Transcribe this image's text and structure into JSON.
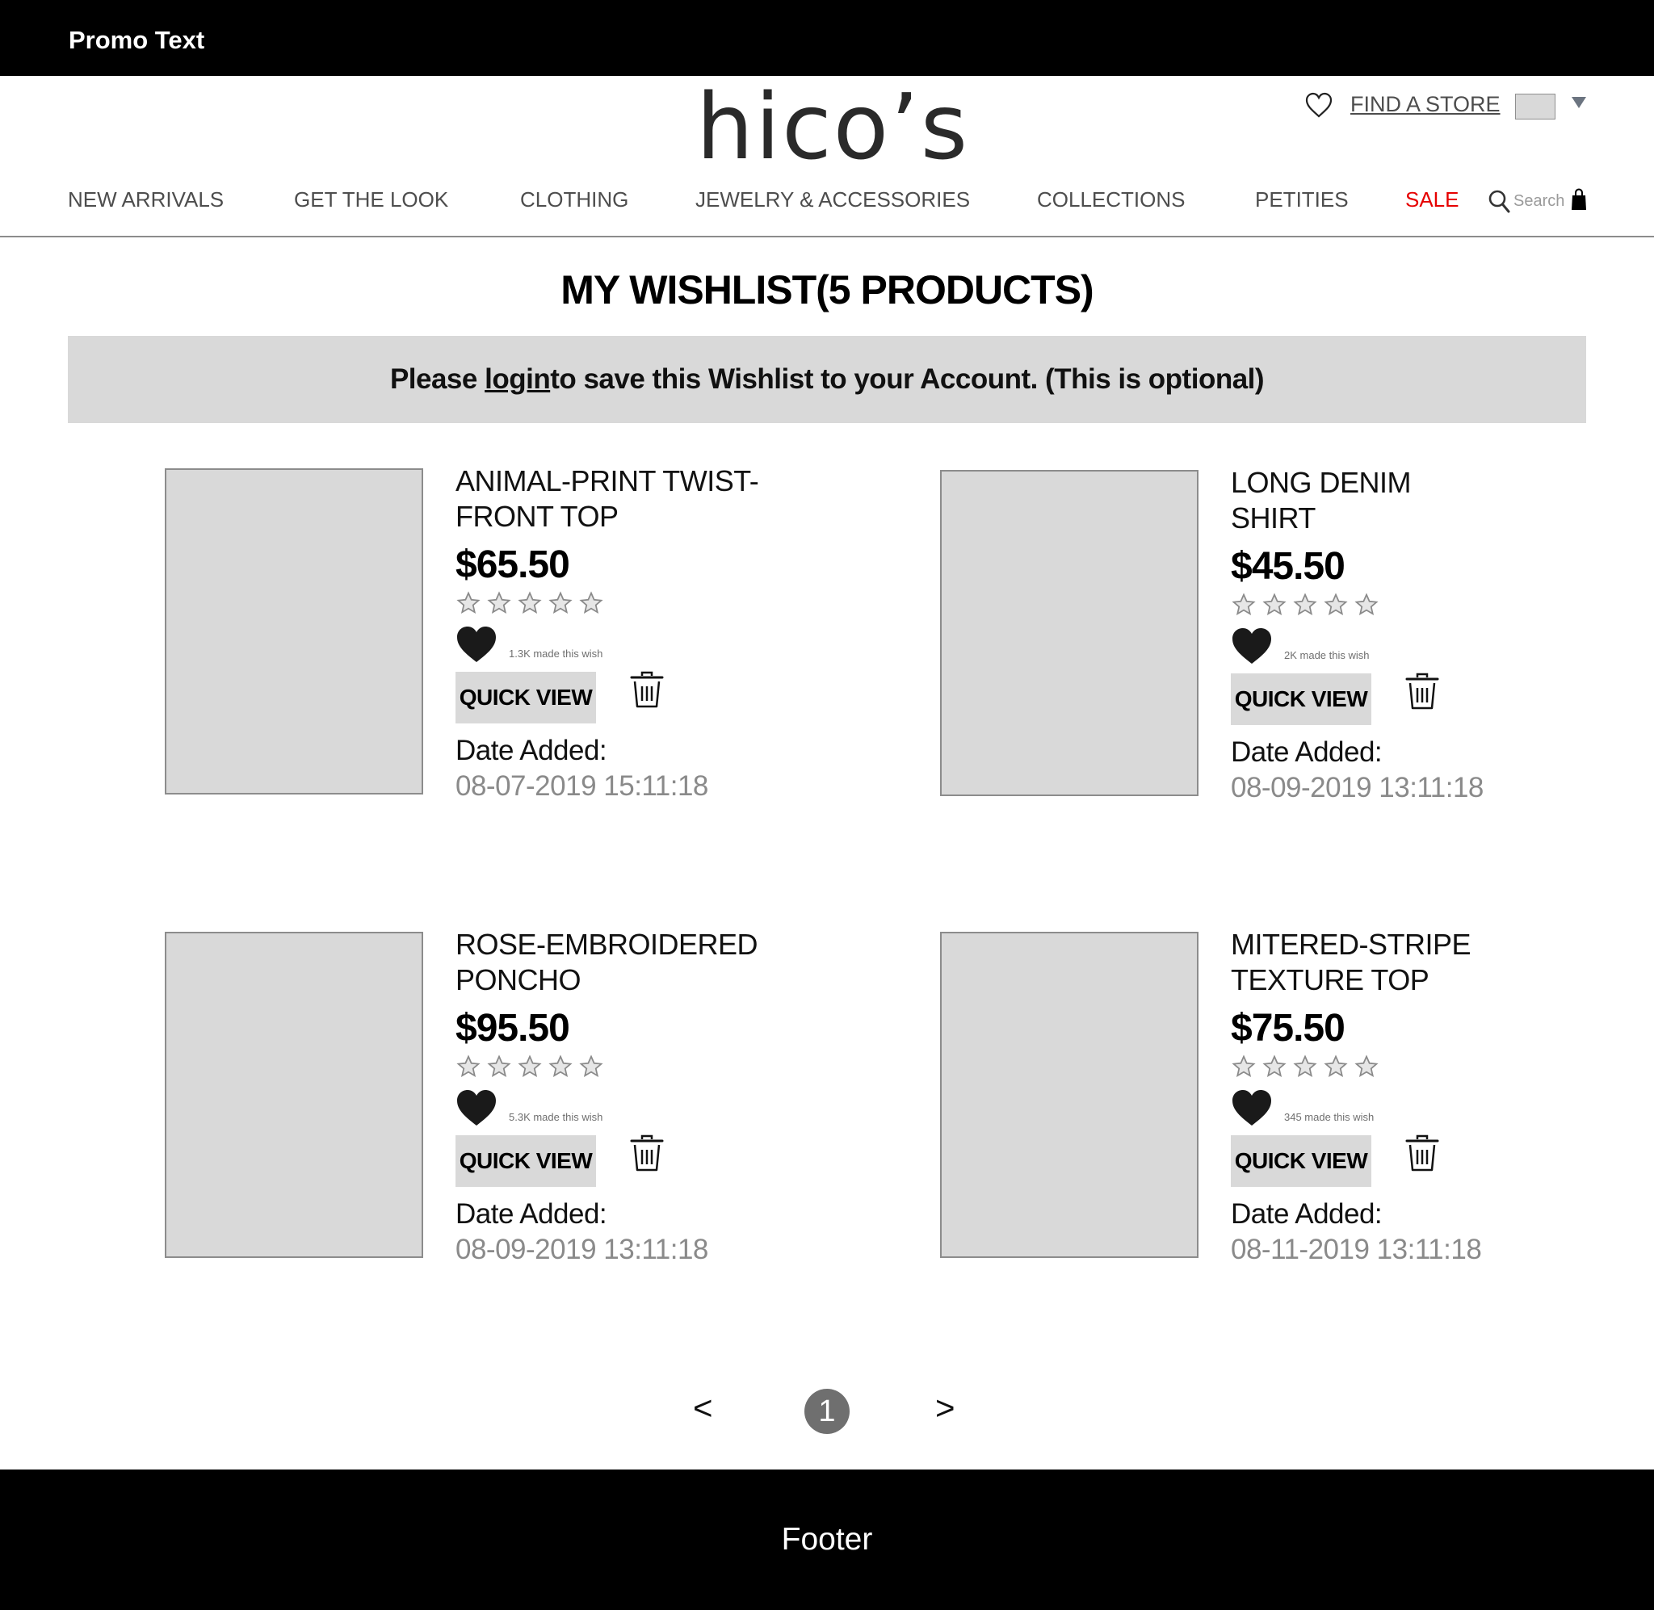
{
  "promo": {
    "text": "Promo Text"
  },
  "header": {
    "logo": "hico’s",
    "find_store": "FIND A STORE",
    "search_placeholder": "Search"
  },
  "nav": [
    {
      "label": "NEW ARRIVALS"
    },
    {
      "label": "GET THE LOOK"
    },
    {
      "label": "CLOTHING"
    },
    {
      "label": "JEWELRY & ACCESSORIES"
    },
    {
      "label": "COLLECTIONS"
    },
    {
      "label": "PETITIES"
    },
    {
      "label": "SALE"
    }
  ],
  "colors": {
    "sale": "#e60000",
    "notice_bg": "#d9d9d9",
    "date": "#8a8a8a"
  },
  "page": {
    "title": "MY WISHLIST(5 PRODUCTS)"
  },
  "notice": {
    "before": "Please ",
    "link": "login",
    "after": " to save this Wishlist to your Account. (This is optional)"
  },
  "products": [
    {
      "name": "ANIMAL-PRINT TWIST-FRONT TOP",
      "price": "$65.50",
      "rating": 0,
      "wish_count": "1.3K made this wish",
      "quick_view": "QUICK VIEW",
      "date_label": "Date Added:",
      "date": "08-07-2019 15:11:18"
    },
    {
      "name": "LONG DENIM SHIRT",
      "price": "$45.50",
      "rating": 0,
      "wish_count": "2K made this wish",
      "quick_view": "QUICK VIEW",
      "date_label": "Date Added:",
      "date": "08-09-2019 13:11:18"
    },
    {
      "name": "ROSE-EMBROIDERED PONCHO",
      "price": "$95.50",
      "rating": 0,
      "wish_count": "5.3K made this wish",
      "quick_view": "QUICK VIEW",
      "date_label": "Date Added:",
      "date": "08-09-2019 13:11:18"
    },
    {
      "name": "MITERED-STRIPE TEXTURE TOP",
      "price": "$75.50",
      "rating": 0,
      "wish_count": "345 made this wish",
      "quick_view": "QUICK VIEW",
      "date_label": "Date Added:",
      "date": "08-11-2019 13:11:18"
    }
  ],
  "pagination": {
    "prev": "<",
    "current": "1",
    "next": ">"
  },
  "footer": {
    "text": "Footer"
  }
}
